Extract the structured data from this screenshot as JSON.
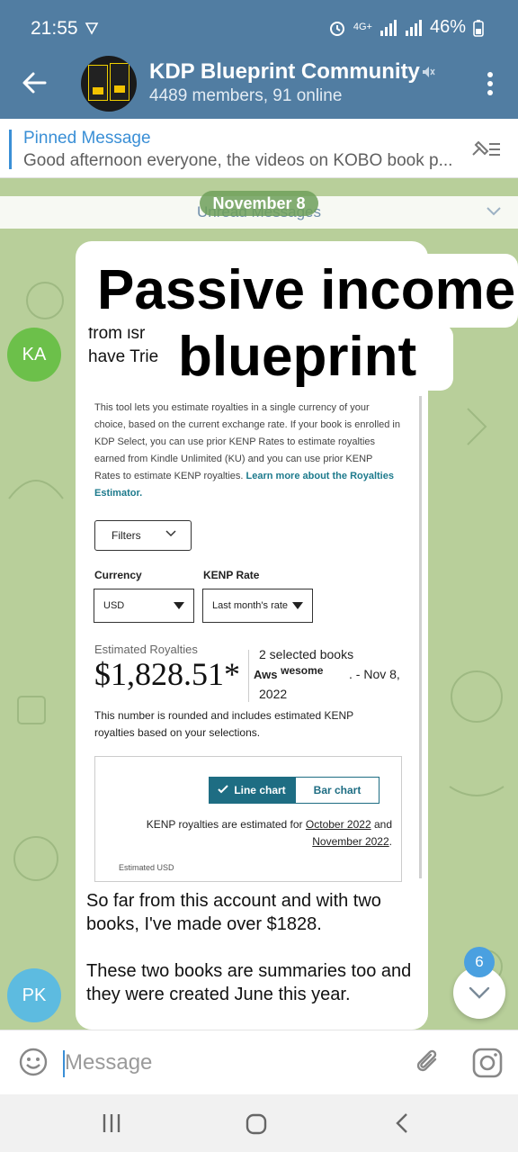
{
  "status_bar": {
    "time": "21:55",
    "network": "4G+",
    "battery": "46%"
  },
  "header": {
    "title": "KDP Blueprint Community",
    "subtitle": "4489 members, 91 online"
  },
  "pinned": {
    "label": "Pinned Message",
    "text": "Good afternoon everyone, the videos on KOBO book p..."
  },
  "date_label": "November 8",
  "unread_label": "Unread Messages",
  "avatars": {
    "ka": "KA",
    "pk": "PK"
  },
  "message": {
    "partial_lines": [
      "from isr",
      "have Trie"
    ],
    "overlay_line1": "Passive income",
    "overlay_line2": "blueprint",
    "caption_p1": "So far from this account and with two books, I've made over $1828.",
    "caption_p2": "These two books are summaries too and they were created June this year."
  },
  "screenshot": {
    "description": "This tool lets you estimate royalties in a single currency of your choice, based on the current exchange rate. If your book is enrolled in KDP Select, you can use prior KENP Rates to estimate royalties earned from Kindle Unlimited (KU) and you can use prior KENP Rates to estimate KENP royalties.",
    "learn_more": "Learn more about the Royalties Estimator.",
    "filters_label": "Filters",
    "currency_label": "Currency",
    "currency_value": "USD",
    "kenp_label": "KENP Rate",
    "kenp_value": "Last month's rate",
    "estimated_label": "Estimated Royalties",
    "estimated_value": "$1,828.51*",
    "books_selected": "2 selected books",
    "date_range_end": ". - Nov 8,",
    "year": "2022",
    "aws_prefix": "Aws",
    "aws_sup": "wesome",
    "rounded_note": "This number is rounded and includes estimated KENP royalties based on your selections.",
    "line_chart": "Line chart",
    "bar_chart": "Bar chart",
    "kenp_note_prefix": "KENP royalties are estimated for",
    "kenp_note_oct": "October 2022",
    "kenp_note_and": "and",
    "kenp_note_nov": "November 2022",
    "estimated_usd": "Estimated USD"
  },
  "unread_count": "6",
  "input": {
    "placeholder": "Message"
  },
  "colors": {
    "header": "#517da2",
    "accent": "#3a8fd6",
    "ka_avatar": "#6cc04a",
    "pk_avatar": "#5dbbe0",
    "amazon_teal": "#1e6d83"
  }
}
